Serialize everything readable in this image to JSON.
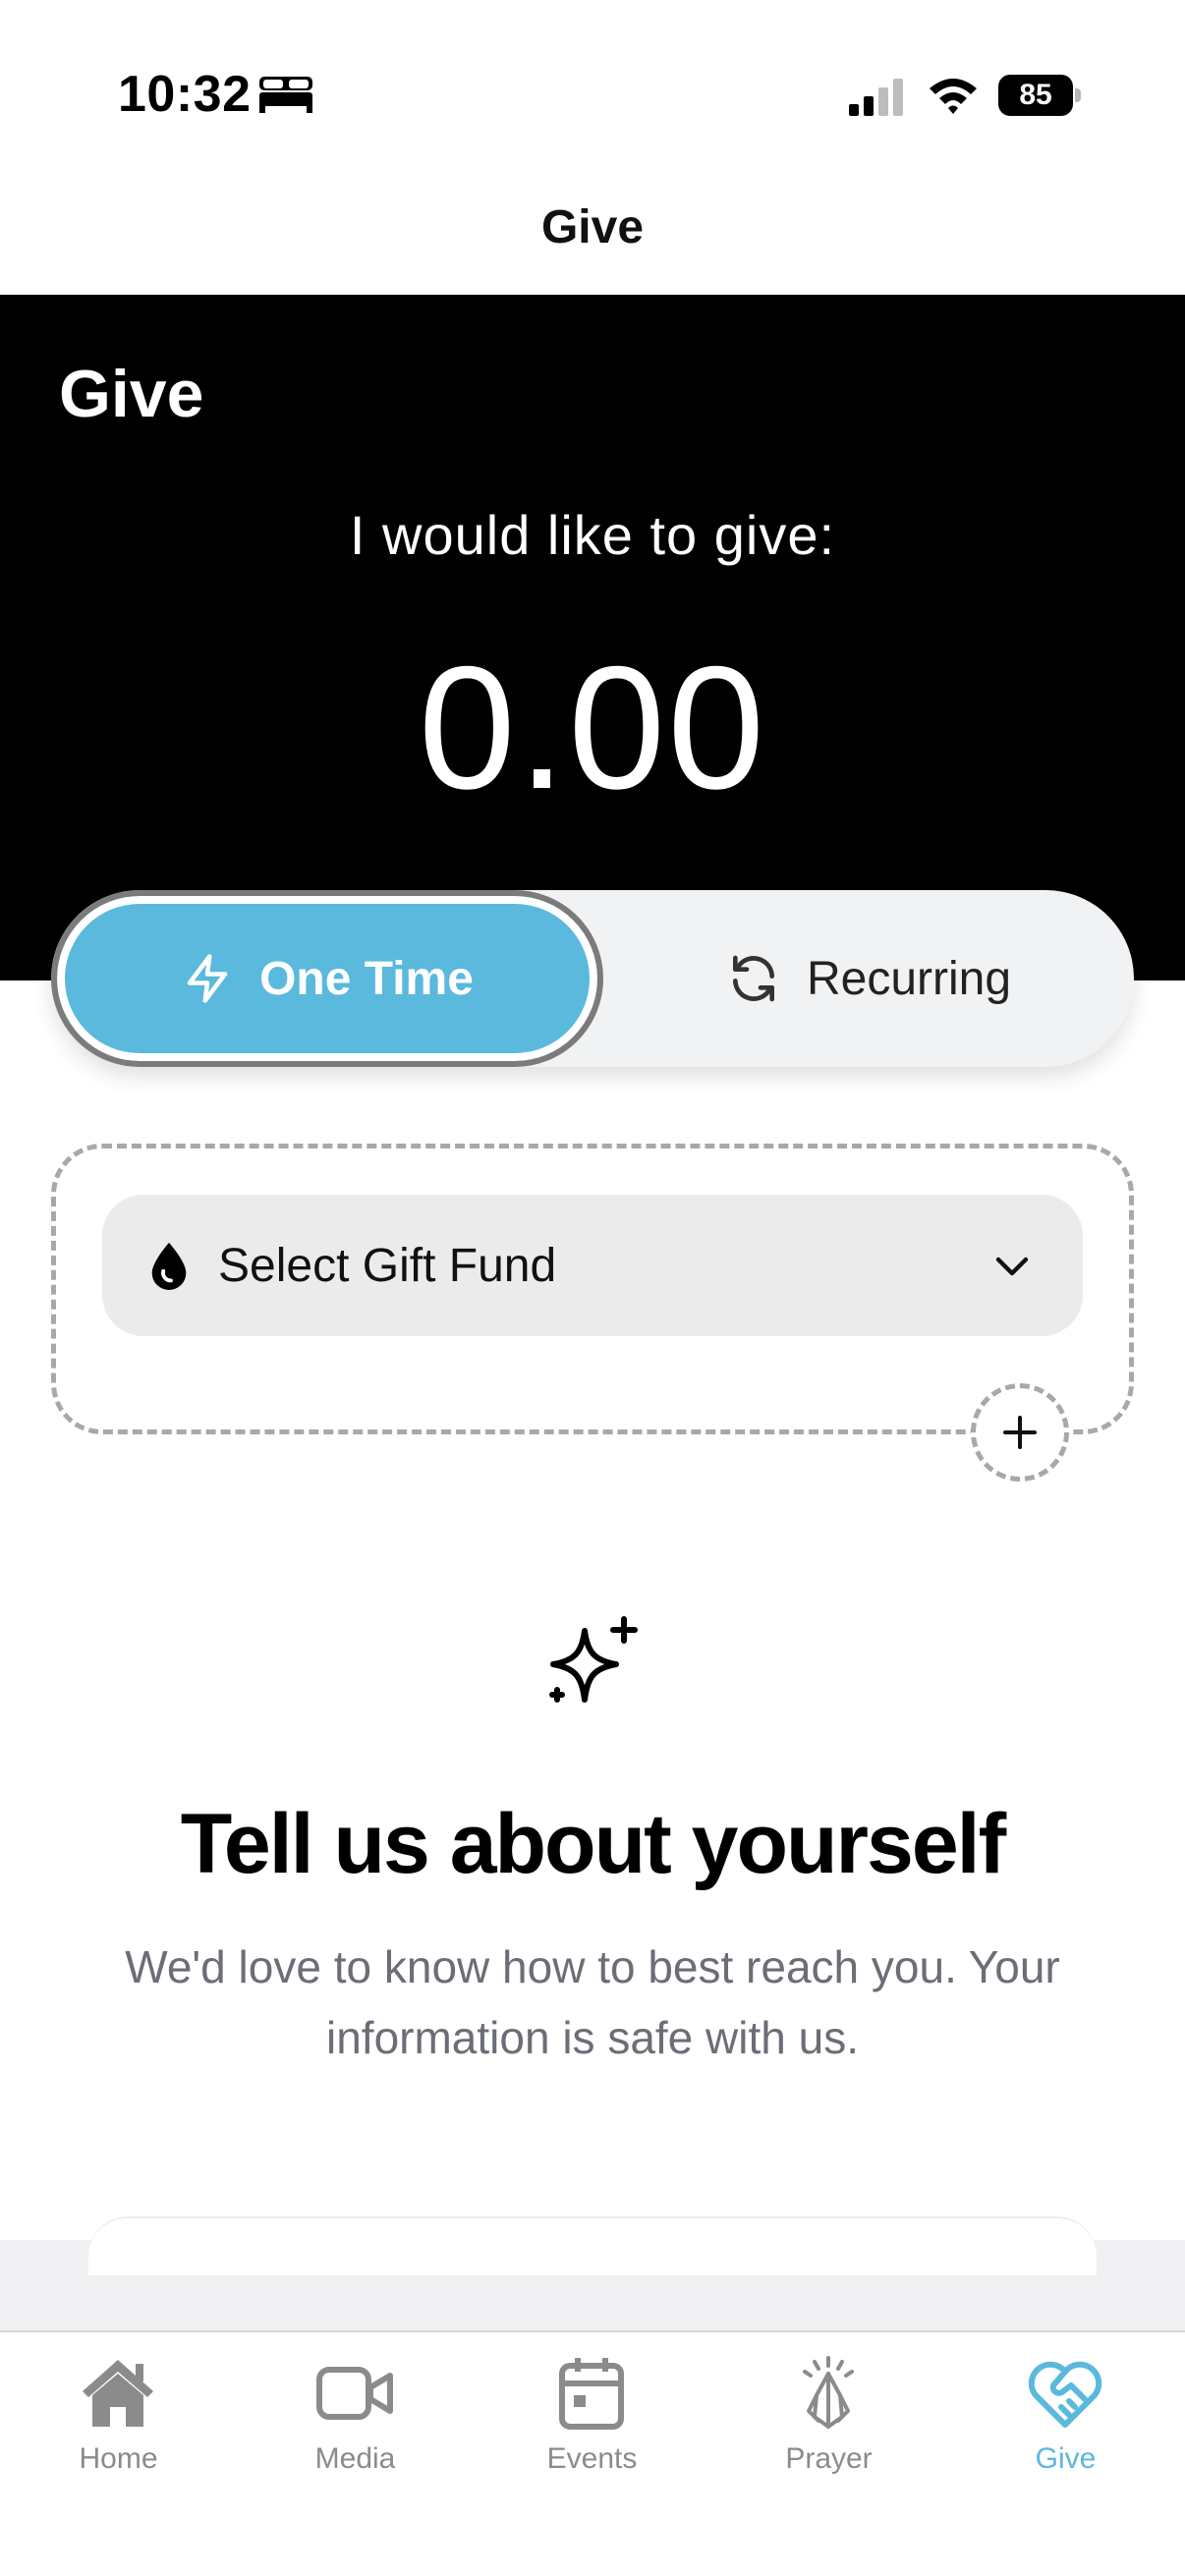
{
  "status_bar": {
    "time": "10:32",
    "battery": "85"
  },
  "nav": {
    "title": "Give"
  },
  "hero": {
    "title": "Give",
    "prompt": "I would like to give:",
    "amount": "0.00"
  },
  "frequency": {
    "options": [
      {
        "label": "One Time",
        "icon": "bolt-icon",
        "selected": true
      },
      {
        "label": "Recurring",
        "icon": "refresh-icon",
        "selected": false
      }
    ]
  },
  "fund": {
    "label": "Select Gift Fund"
  },
  "about": {
    "title": "Tell us about yourself",
    "description": "We'd love to know how to best reach you. Your information is safe with us."
  },
  "tabs": [
    {
      "label": "Home",
      "icon": "home-icon"
    },
    {
      "label": "Media",
      "icon": "video-icon"
    },
    {
      "label": "Events",
      "icon": "calendar-icon"
    },
    {
      "label": "Prayer",
      "icon": "prayer-hands-icon"
    },
    {
      "label": "Give",
      "icon": "heart-handshake-icon",
      "active": true
    }
  ],
  "colors": {
    "accent": "#5ab9dd",
    "hero_bg": "#000000",
    "tab_inactive": "#8b8b8b",
    "muted_text": "#6b6e76"
  }
}
